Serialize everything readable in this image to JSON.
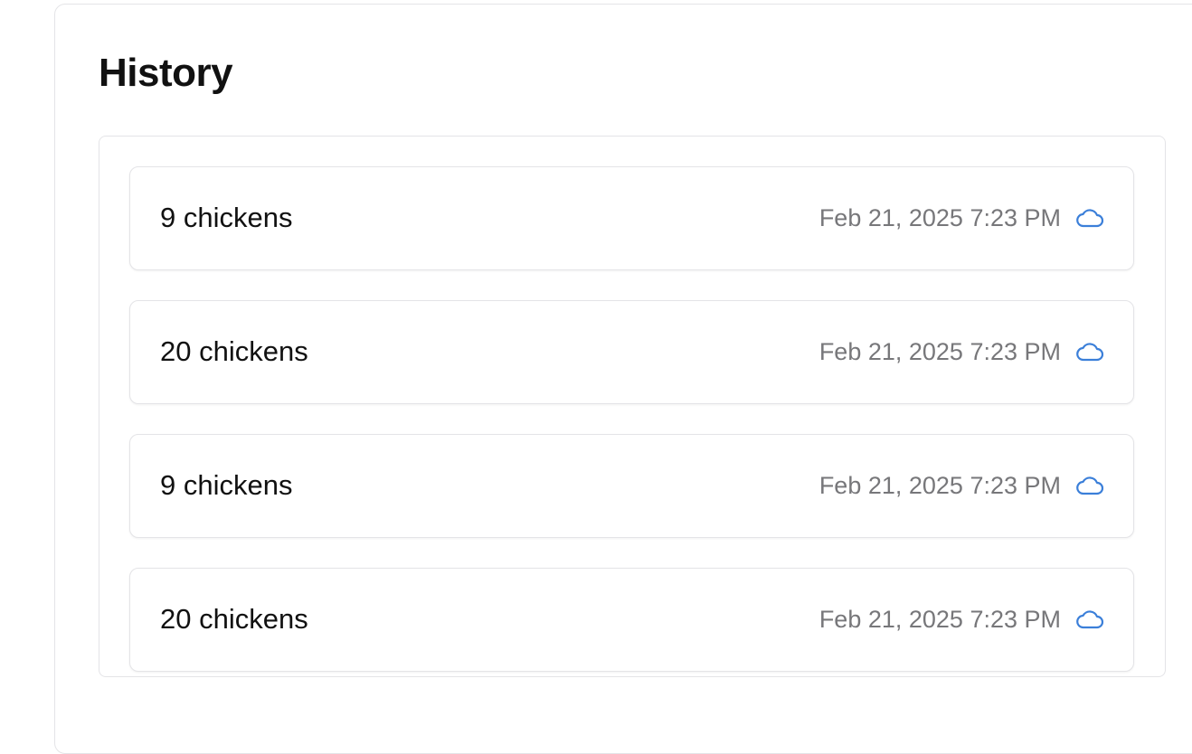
{
  "history": {
    "title": "History",
    "items": [
      {
        "label": "9 chickens",
        "timestamp": "Feb 21, 2025 7:23 PM",
        "status_icon": "cloud-icon"
      },
      {
        "label": "20 chickens",
        "timestamp": "Feb 21, 2025 7:23 PM",
        "status_icon": "cloud-icon"
      },
      {
        "label": "9 chickens",
        "timestamp": "Feb 21, 2025 7:23 PM",
        "status_icon": "cloud-icon"
      },
      {
        "label": "20 chickens",
        "timestamp": "Feb 21, 2025 7:23 PM",
        "status_icon": "cloud-icon"
      }
    ]
  },
  "colors": {
    "accent": "#3b7fd9",
    "border": "#e4e4e7",
    "muted_text": "#77777a",
    "text": "#111111"
  }
}
